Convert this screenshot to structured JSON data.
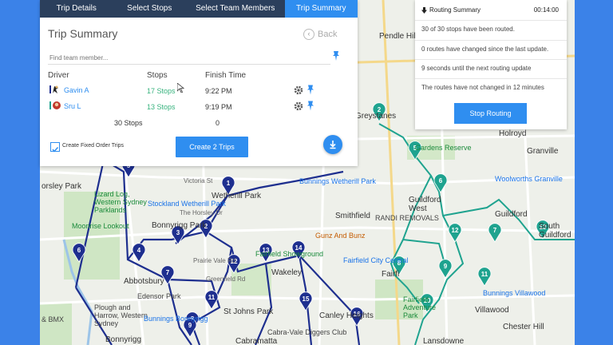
{
  "tabs": [
    {
      "label": "Trip Details",
      "active": false
    },
    {
      "label": "Select Stops",
      "active": false
    },
    {
      "label": "Select Team Members",
      "active": false
    },
    {
      "label": "Trip Summary",
      "active": true
    }
  ],
  "trip_summary": {
    "title": "Trip Summary",
    "back_label": "Back",
    "find_placeholder": "Find team member...",
    "columns": {
      "driver": "Driver",
      "stops": "Stops",
      "finish": "Finish Time"
    },
    "drivers": [
      {
        "name": "Gavin A",
        "stops": "17 Stops",
        "finish": "9:22 PM"
      },
      {
        "name": "Sru L",
        "stops": "13 Stops",
        "finish": "9:19 PM"
      }
    ],
    "totals": {
      "stops": "30 Stops",
      "finish": "0"
    },
    "fixed_order_label": "Create Fixed Order Trips",
    "fixed_order_checked": true,
    "create_button": "Create 2 Trips"
  },
  "routing_summary": {
    "title": "Routing Summary",
    "timer": "00:14:00",
    "lines": [
      "30 of 30 stops have been routed.",
      "0 routes have changed since the last update.",
      "9 seconds until the next routing update",
      "The routes have not changed in 12 minutes"
    ],
    "stop_button": "Stop Routing"
  },
  "colors": {
    "route_navy": "#1e2f8f",
    "route_teal": "#1fa38f",
    "accent": "#2f8ef0",
    "tab_bar": "#2b3f5c"
  },
  "map": {
    "places": [
      "Pendle Hill",
      "Greystanes",
      "Holroyd",
      "Granville",
      "Woolworths Granville",
      "orsley Park",
      "Lizard Log, Western Sydney Parklands",
      "Moonrise Lookout",
      "Wetherill Park",
      "Stockland Wetherill Park",
      "Bonnyrigg Park",
      "Abbotsbury",
      "Fairfield Showground",
      "Bunnings Wetherill Park",
      "Smithfield",
      "RANDI REMOVALS",
      "Gunz And Bunz",
      "Fairfield City Central",
      "Guildford West",
      "Guildford",
      "South Guildford",
      "Wakeley",
      "Plough and Harrow, Western Sydney",
      "Edensor Park",
      "Bunnings Bonnyrigg",
      "St Johns Park",
      "Canley Heights",
      "Cabra-Vale Diggers Club",
      "Fairfield Adventure Park",
      "Bunnings Villawood",
      "Villawood",
      "Chester Hill",
      "Bonnyrigg",
      "Cabramatta",
      "Lansdowne",
      "& BMX",
      "Victoria St",
      "The Horsley Dr",
      "Prairie Vale Rd",
      "Greenfield Rd",
      "Gardens Reserve",
      "Fairfi"
    ],
    "markers": {
      "navy": [
        {
          "n": "1"
        },
        {
          "n": "2"
        },
        {
          "n": "3"
        },
        {
          "n": "4"
        },
        {
          "n": "5"
        },
        {
          "n": "6"
        },
        {
          "n": "7"
        },
        {
          "n": "8"
        },
        {
          "n": "9"
        },
        {
          "n": "11"
        },
        {
          "n": "12"
        },
        {
          "n": "13"
        },
        {
          "n": "14"
        },
        {
          "n": "15"
        },
        {
          "n": "16"
        }
      ],
      "teal": [
        {
          "n": "2"
        },
        {
          "n": "5"
        },
        {
          "n": "6"
        },
        {
          "n": "7"
        },
        {
          "n": "8"
        },
        {
          "n": "9"
        },
        {
          "n": "10"
        },
        {
          "n": "11"
        },
        {
          "n": "12"
        },
        {
          "n": "13"
        }
      ]
    }
  }
}
